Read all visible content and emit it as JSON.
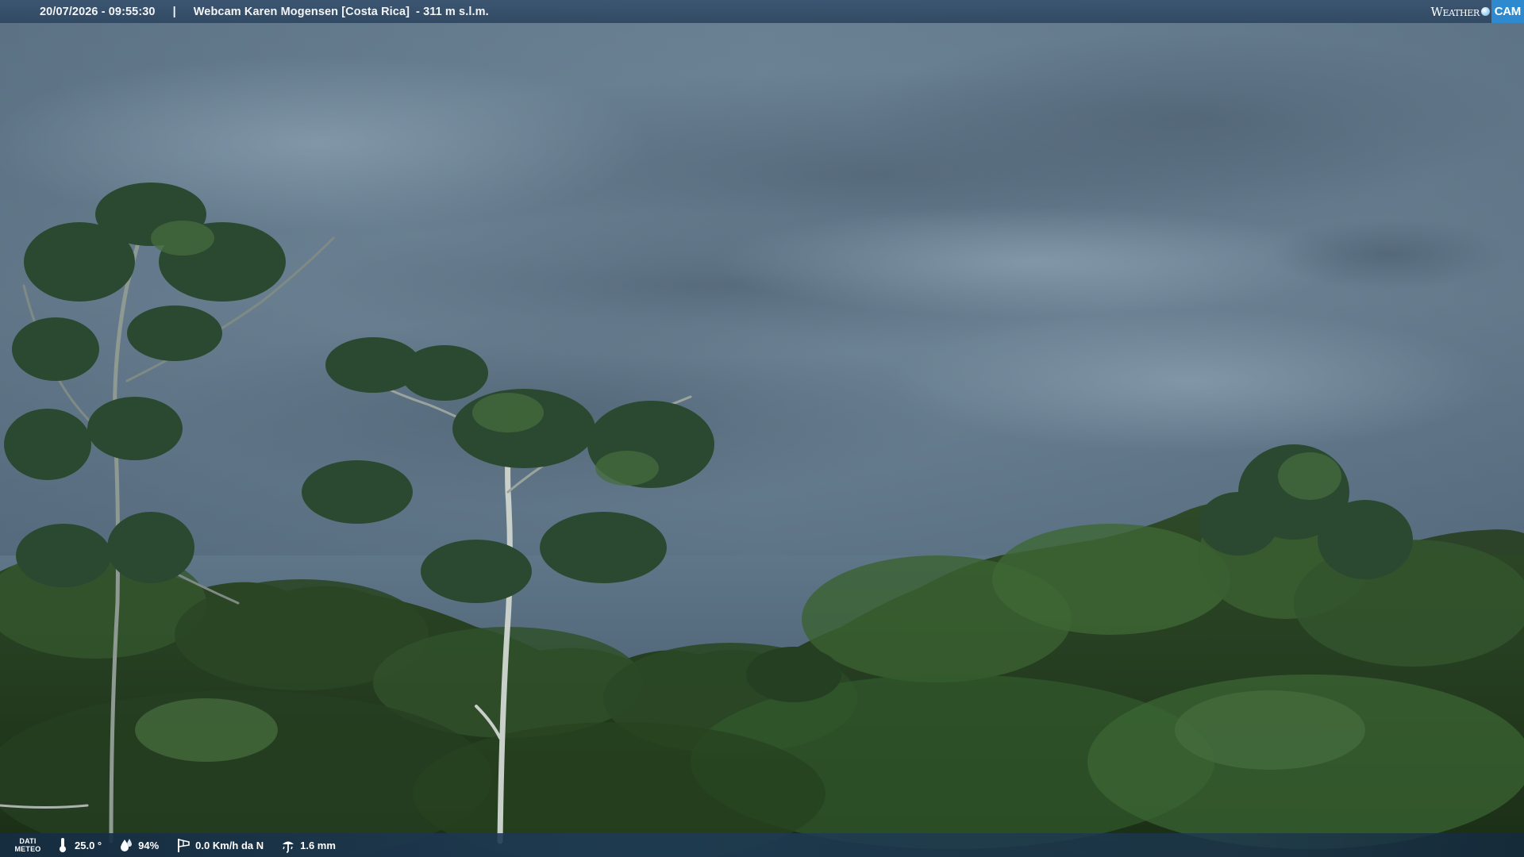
{
  "header": {
    "datetime": "20/07/2026 - 09:55:30",
    "separator": "|",
    "title": "Webcam Karen Mogensen [Costa Rica]",
    "altitude": "- 311 m s.l.m."
  },
  "logo": {
    "weather": "Weather",
    "cam": "CAM"
  },
  "weather_bar": {
    "label_line1": "DATI",
    "label_line2": "METEO",
    "temperature": "25.0 °",
    "humidity": "94%",
    "wind": "0.0 Km/h da N",
    "rain": "1.6 mm"
  },
  "icons": {
    "temperature": "thermometer-icon",
    "humidity": "drops-icon",
    "wind": "wind-sock-icon",
    "rain": "rain-gauge-icon"
  },
  "colors": {
    "bar_text": "#ffffff",
    "logo_cam_bg": "#2f89cf"
  }
}
